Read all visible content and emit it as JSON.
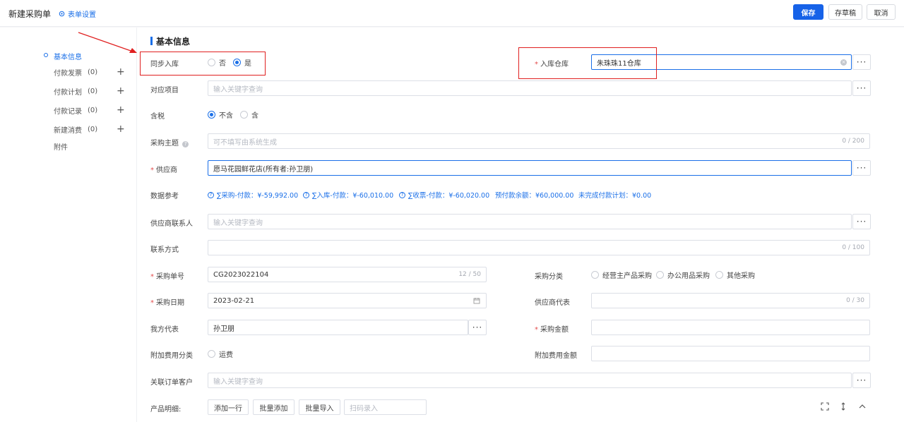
{
  "header": {
    "title": "新建采购单",
    "settings_label": "表单设置",
    "save_label": "保存",
    "draft_label": "存草稿",
    "cancel_label": "取消"
  },
  "sidebar": {
    "items": [
      {
        "label": "基本信息",
        "count": ""
      },
      {
        "label": "付款发票",
        "count": "(0)"
      },
      {
        "label": "付款计划",
        "count": "(0)"
      },
      {
        "label": "付款记录",
        "count": "(0)"
      },
      {
        "label": "新建消费",
        "count": "(0)"
      },
      {
        "label": "附件",
        "count": ""
      }
    ]
  },
  "section": {
    "title": "基本信息"
  },
  "form": {
    "sync_stock": {
      "label": "同步入库",
      "options": [
        "否",
        "是"
      ],
      "selected": "是"
    },
    "warehouse": {
      "label": "入库仓库",
      "value": "朱珠珠11仓库"
    },
    "project": {
      "label": "对应项目",
      "placeholder": "输入关键字查询"
    },
    "tax": {
      "label": "含税",
      "options": [
        "不含",
        "含"
      ],
      "selected": "不含"
    },
    "subject": {
      "label": "采购主题",
      "placeholder": "可不填写由系统生成",
      "counter": "0 / 200"
    },
    "supplier": {
      "label": "供应商",
      "value": "愿马花园鲜花店(所有者:孙卫朋)"
    },
    "data_ref": {
      "label": "数据参考",
      "items": [
        "∑采购-付款：¥-59,992.00",
        "∑入库-付款：¥-60,010.00",
        "∑收票-付款：¥-60,020.00",
        "预付款余额：¥60,000.00",
        "未完成付款计划：¥0.00"
      ]
    },
    "supplier_contact": {
      "label": "供应商联系人",
      "placeholder": "输入关键字查询"
    },
    "contact_method": {
      "label": "联系方式",
      "counter": "0 / 100"
    },
    "order_no": {
      "label": "采购单号",
      "value": "CG2023022104",
      "counter": "12 / 50"
    },
    "purchase_category": {
      "label": "采购分类",
      "options": [
        "经营主产品采购",
        "办公用品采购",
        "其他采购"
      ]
    },
    "purchase_date": {
      "label": "采购日期",
      "value": "2023-02-21"
    },
    "supplier_rep": {
      "label": "供应商代表",
      "counter": "0 / 30"
    },
    "our_rep": {
      "label": "我方代表",
      "value": "孙卫朋"
    },
    "amount": {
      "label": "采购金额",
      "value": ""
    },
    "extra_fee_category": {
      "label": "附加费用分类",
      "options": [
        "运费"
      ]
    },
    "extra_fee_amount": {
      "label": "附加费用金额",
      "value": ""
    },
    "linked_customer": {
      "label": "关联订单客户",
      "placeholder": "输入关键字查询"
    },
    "product_detail": {
      "label": "产品明细:",
      "add_row": "添加一行",
      "batch_add": "批量添加",
      "batch_import": "批量导入",
      "scan_placeholder": "扫码录入"
    }
  },
  "colors": {
    "accent": "#1662e8",
    "annotation": "#e02020",
    "required": "#e34d4d"
  }
}
